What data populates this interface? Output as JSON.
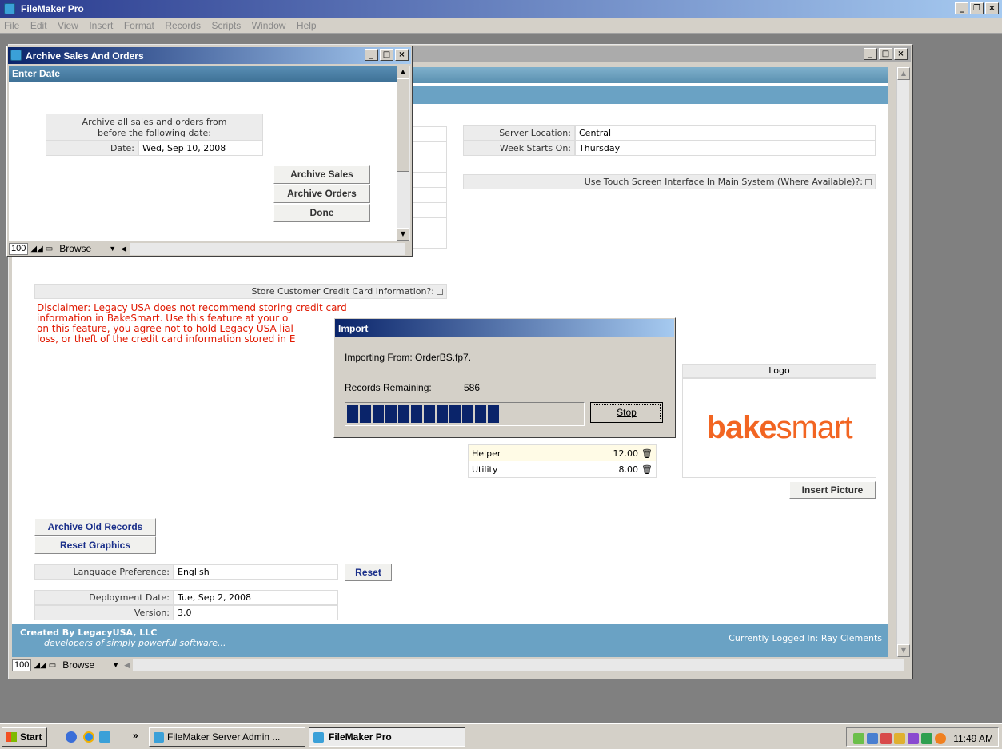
{
  "app": {
    "title": "FileMaker Pro"
  },
  "menu": [
    "File",
    "Edit",
    "View",
    "Insert",
    "Format",
    "Records",
    "Scripts",
    "Window",
    "Help"
  ],
  "main": {
    "server_location_label": "Server Location:",
    "server_location_value": "Central",
    "week_starts_label": "Week Starts On:",
    "week_starts_value": "Thursday",
    "touch_screen_label": "Use Touch Screen Interface In Main System (Where Available)?:",
    "credit_card_label": "Store Customer Credit Card Information?:",
    "disclaimer_lines": [
      "Disclaimer: Legacy USA does not recommend storing credit card",
      "information in BakeSmart.  Use this feature at your o",
      "on this feature, you agree not to hold Legacy USA lial",
      "loss, or theft of the credit card information stored in E"
    ],
    "roles": [
      {
        "name": "Helper",
        "value": "12.00"
      },
      {
        "name": "Utility",
        "value": "8.00"
      }
    ],
    "logo_label": "Logo",
    "logo_text_a": "bake",
    "logo_text_b": "smart",
    "insert_picture": "Insert Picture",
    "archive_old_records": "Archive Old Records",
    "reset_graphics": "Reset Graphics",
    "language_label": "Language Preference:",
    "language_value": "English",
    "reset": "Reset",
    "deployment_label": "Deployment Date:",
    "deployment_value": "Tue, Sep 2, 2008",
    "version_label": "Version:",
    "version_value": "3.0",
    "footer_company": "Created By LegacyUSA, LLC",
    "footer_tagline": "developers of simply powerful software...",
    "footer_user": "Currently Logged In: Ray Clements",
    "zoom": "100",
    "mode": "Browse"
  },
  "archive": {
    "window_title": "Archive Sales And Orders",
    "header": "Enter Date",
    "instruction_1": "Archive all sales and orders from",
    "instruction_2": "before the following date:",
    "date_label": "Date:",
    "date_value": "Wed, Sep 10, 2008",
    "archive_sales": "Archive Sales",
    "archive_orders": "Archive Orders",
    "done": "Done",
    "zoom": "100",
    "mode": "Browse"
  },
  "import": {
    "title": "Import",
    "importing_from": "Importing From: OrderBS.fp7.",
    "records_remaining_label": "Records Remaining:",
    "records_remaining_value": "586",
    "stop": "Stop",
    "progress_blocks": 12,
    "progress_fraction": 0.68
  },
  "taskbar": {
    "start": "Start",
    "chevron": "»",
    "task_1": "FileMaker Server Admin ...",
    "task_2": "FileMaker Pro",
    "clock": "11:49 AM"
  },
  "colors": {
    "title_gradient_start": "#0a246a",
    "header_blue": "#6aa2c4",
    "disclaimer_red": "#e01800",
    "logo_orange": "#f26522"
  }
}
